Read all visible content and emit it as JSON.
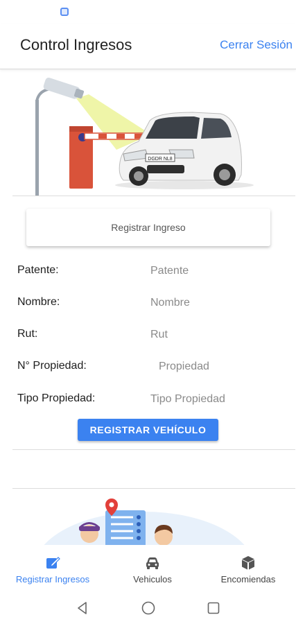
{
  "header": {
    "title": "Control Ingresos",
    "logout_label": "Cerrar Sesión"
  },
  "hero": {
    "plate_text": "DGDR NL8"
  },
  "register_card": {
    "label": "Registrar Ingreso"
  },
  "form": {
    "fields": [
      {
        "label": "Patente:",
        "placeholder": "Patente"
      },
      {
        "label": "Nombre:",
        "placeholder": "Nombre"
      },
      {
        "label": "Rut:",
        "placeholder": "Rut"
      },
      {
        "label": "N° Propiedad:",
        "placeholder": "Propiedad"
      },
      {
        "label": "Tipo Propiedad:",
        "placeholder": "Tipo Propiedad"
      }
    ],
    "submit_label": "REGISTRAR VEHÍCULO"
  },
  "bottom_nav": {
    "items": [
      {
        "label": "Registrar Ingresos",
        "icon": "edit-icon",
        "active": true
      },
      {
        "label": "Vehiculos",
        "icon": "car-icon",
        "active": false
      },
      {
        "label": "Encomiendas",
        "icon": "package-icon",
        "active": false
      }
    ]
  },
  "colors": {
    "accent": "#3b82f0",
    "text": "#222222",
    "placeholder": "#8a8a8a",
    "barrier": "#d9533a"
  }
}
